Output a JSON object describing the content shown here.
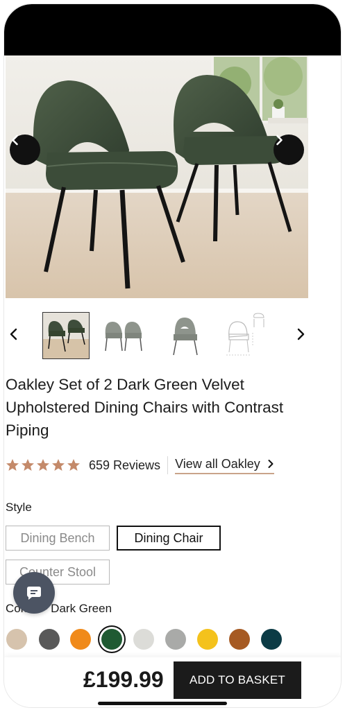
{
  "gallery": {
    "prev_icon": "chevron-left-icon",
    "next_icon": "chevron-right-icon",
    "thumb_prev_icon": "chevron-left-icon",
    "thumb_next_icon": "chevron-right-icon"
  },
  "product": {
    "title": "Oakley Set of 2 Dark Green Velvet Upholstered Dining Chairs with Contrast Piping",
    "rating": 5,
    "reviews": "659 Reviews",
    "view_all": "View all Oakley"
  },
  "style": {
    "label": "Style",
    "options": [
      "Dining Bench",
      "Dining Chair",
      "Counter Stool"
    ],
    "selected": "Dining Chair"
  },
  "colour": {
    "label": "Colour - Dark Green",
    "swatches": [
      {
        "name": "beige",
        "color": "#d6c3ad"
      },
      {
        "name": "charcoal",
        "color": "#595959"
      },
      {
        "name": "orange",
        "color": "#f08a1a"
      },
      {
        "name": "dark-green",
        "color": "#1f5a32"
      },
      {
        "name": "boucle-white",
        "color": "#dcdcd8"
      },
      {
        "name": "grey",
        "color": "#a9aaa8"
      },
      {
        "name": "yellow",
        "color": "#f4c21c"
      },
      {
        "name": "rust",
        "color": "#a65a23"
      },
      {
        "name": "teal",
        "color": "#0c3b45"
      }
    ],
    "selected": "dark-green"
  },
  "purchase": {
    "price": "£199.99",
    "add_label": "ADD TO BASKET"
  },
  "chat": {
    "icon": "chat-bubble-icon"
  },
  "colors": {
    "accent_underline": "#c9a38a",
    "star": "#c48a6a",
    "button_dark": "#1b1b1b"
  }
}
